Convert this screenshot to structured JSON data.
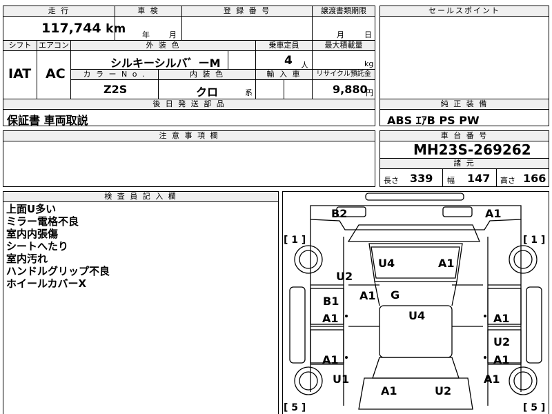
{
  "top": {
    "mileage_header": "走 行",
    "inspection_header": "車 検",
    "registration_header": "登 録 番 号",
    "transfer_header": "譲渡書類期限",
    "sales_point_header": "セールスポイント",
    "mileage_value": "117,744",
    "mileage_unit": "km",
    "inspection_year": "年",
    "inspection_month": "月",
    "transfer_month": "月",
    "transfer_day": "日"
  },
  "spec": {
    "shift_header": "シフト",
    "aircon_header": "エアコン",
    "exterior_color_header": "外 装 色",
    "capacity_header": "乗車定員",
    "max_load_header": "最大積載量",
    "shift_value": "IAT",
    "aircon_value": "AC",
    "exterior_color_value": "シルキーシルバ゛ーM",
    "capacity_value": "4",
    "capacity_unit": "人",
    "max_load_unit": "kg",
    "color_no_header": "カ ラ ー N o .",
    "interior_color_header": "内 装 色",
    "import_header": "輸 入 車",
    "recycle_header": "リサイクル預託金",
    "color_no_value": "Z2S",
    "interior_color_value": "クロ",
    "interior_suffix": "系",
    "recycle_value": "9,880",
    "recycle_unit": "円"
  },
  "parts": {
    "header": "後 日 発 送 部 品",
    "value": "保証書 車両取説"
  },
  "equipment": {
    "header": "純 正 装 備",
    "value": "ABS ｴｱB PS PW"
  },
  "notes": {
    "header": "注 意 事 項 欄"
  },
  "chassis": {
    "header": "車 台 番 号",
    "value": "MH23S-269262"
  },
  "dimensions": {
    "header": "諸 元",
    "length_label": "長さ",
    "length_value": "339",
    "width_label": "幅",
    "width_value": "147",
    "height_label": "高さ",
    "height_value": "166"
  },
  "inspector": {
    "header": "検 査 員 記 入 欄",
    "lines": [
      "上面U多い",
      "ミラー電格不良",
      "室内内張傷",
      "シートへたり",
      "室内汚れ",
      "ハンドルグリップ不良",
      "ホイールカバーX"
    ]
  },
  "diagram": {
    "marks": {
      "b2": "B2",
      "a1_top_right": "A1",
      "u4_front": "U4",
      "a1_front_right": "A1",
      "u2_left": "U2",
      "a1_windshield": "A1",
      "g_windshield": "G",
      "b1_left": "B1",
      "u4_roof": "U4",
      "a1_left_front_door": "A1",
      "a1_right_front_door": "A1",
      "u2_right_rear_door": "U2",
      "a1_left_rear_door": "A1",
      "a1_right_rear_door": "A1",
      "u1_left_rear": "U1",
      "a1_right_rear": "A1",
      "a1_rear": "A1",
      "u2_rear": "U2"
    },
    "brackets": {
      "left_top": "[ 1 ]",
      "right_top": "[ 1 ]",
      "left_bottom": "[ 5 ]",
      "right_bottom": "[ 5 ]"
    }
  }
}
